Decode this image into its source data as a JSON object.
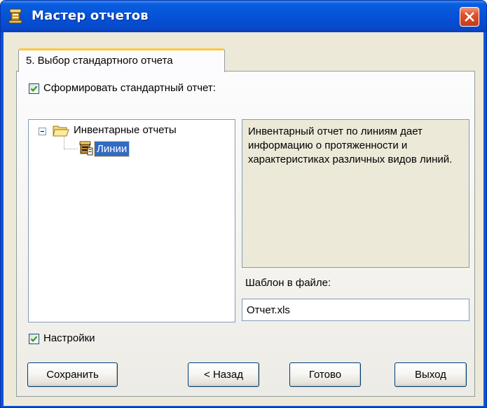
{
  "window": {
    "title": "Мастер отчетов",
    "icons": {
      "app": "report-wizard-icon",
      "close": "close-icon"
    },
    "colors": {
      "titlebar": "#0552d6",
      "close_button": "#e0532a",
      "selection": "#316ac5",
      "tab_highlight": "#ffc83c"
    }
  },
  "tab": {
    "label": "5. Выбор стандартного отчета"
  },
  "generate_checkbox": {
    "label": "Сформировать стандартный отчет:",
    "checked": true
  },
  "tree": {
    "root": {
      "label": "Инвентарные отчеты",
      "expanded": true,
      "icon": "folder-open-icon",
      "expander_icon": "collapse-icon"
    },
    "children": [
      {
        "label": "Линии",
        "selected": true,
        "icon": "report-icon"
      }
    ]
  },
  "description": {
    "text": "Инвентарный отчет по линиям дает информацию о протяженности и характеристиках различных видов линий."
  },
  "template": {
    "label": "Шаблон в файле:",
    "value": "Отчет.xls"
  },
  "settings_checkbox": {
    "label": "Настройки",
    "checked": true
  },
  "buttons": {
    "save": "Сохранить",
    "back": "< Назад",
    "done": "Готово",
    "exit": "Выход"
  }
}
